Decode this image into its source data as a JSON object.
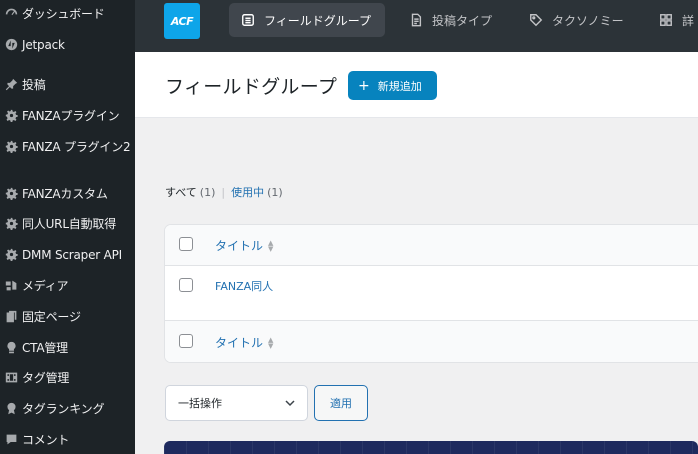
{
  "sidebar": {
    "items": [
      {
        "label": "ダッシュボード",
        "icon": "dashboard-icon"
      },
      {
        "label": "Jetpack",
        "icon": "jetpack-icon"
      },
      {
        "label": "投稿",
        "icon": "pin-icon"
      },
      {
        "label": "FANZAプラグイン",
        "icon": "gear-icon"
      },
      {
        "label": "FANZA プラグイン2",
        "icon": "gear-icon"
      },
      {
        "label": "FANZAカスタム",
        "icon": "gear-icon"
      },
      {
        "label": "同人URL自動取得",
        "icon": "gear-icon"
      },
      {
        "label": "DMM Scraper API",
        "icon": "gear-icon"
      },
      {
        "label": "メディア",
        "icon": "media-icon"
      },
      {
        "label": "固定ページ",
        "icon": "page-icon"
      },
      {
        "label": "CTA管理",
        "icon": "lightbulb-icon"
      },
      {
        "label": "タグ管理",
        "icon": "film-icon"
      },
      {
        "label": "タグランキング",
        "icon": "award-icon"
      },
      {
        "label": "コメント",
        "icon": "comment-icon"
      }
    ]
  },
  "topbar": {
    "logo": "ACF",
    "tabs": [
      {
        "label": "フィールドグループ",
        "active": true
      },
      {
        "label": "投稿タイプ",
        "active": false
      },
      {
        "label": "タクソノミー",
        "active": false
      },
      {
        "label": "詳",
        "active": false
      }
    ]
  },
  "header": {
    "title": "フィールドグループ",
    "add_label": "新規追加"
  },
  "filters": {
    "all_label": "すべて",
    "all_count": "(1)",
    "separator": "|",
    "active_label": "使用中",
    "active_count": "(1)"
  },
  "table": {
    "column_title": "タイトル",
    "rows": [
      {
        "title": "FANZA同人"
      }
    ],
    "footer_column_title": "タイトル"
  },
  "bulk": {
    "select_value": "一括操作",
    "apply_label": "適用"
  },
  "colors": {
    "sidebar_bg": "#1d2327",
    "topbar_bg": "#2c3338",
    "accent": "#0783be",
    "link": "#2271b1"
  }
}
